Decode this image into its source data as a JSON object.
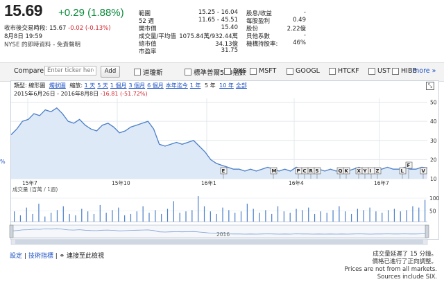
{
  "quote": {
    "price": "15.69",
    "change": "+0.29 (1.88%)",
    "after_hours_label": "收市後交易時段:",
    "after_hours_price": "15.67",
    "after_hours_change": "-0.02 (-0.13%)",
    "timestamp": "8月8日 19:59",
    "source_text": "NYSE 的即時資料 - 免責聲明"
  },
  "stats_left": [
    {
      "label": "範圍",
      "value": "15.25 - 16.04"
    },
    {
      "label": "52 週",
      "value": "11.65 - 45.51"
    },
    {
      "label": "開市價",
      "value": "15.40"
    },
    {
      "label": "成交量/平均值",
      "value": "1075.84萬/932.44萬"
    },
    {
      "label": "總市值",
      "value": "34.13億"
    },
    {
      "label": "市盈率",
      "value": "31.75"
    }
  ],
  "stats_right": [
    {
      "label": "股息/收益",
      "value": "-"
    },
    {
      "label": "每股盈利",
      "value": "0.49"
    },
    {
      "label": "股份",
      "value": "2.22億"
    },
    {
      "label": "貝他系數",
      "value": "-"
    },
    {
      "label": "機構持股率:",
      "value": "46%"
    }
  ],
  "compare": {
    "label": "Compare:",
    "placeholder": "Enter ticker here",
    "add_label": "Add",
    "checkboxes": [
      "道瓊斯",
      "標準普爾500指數",
      "DKS",
      "MSFT",
      "GOOGL",
      "HTCKF",
      "UST",
      "HIBB"
    ],
    "more_label": "more »"
  },
  "chart_controls": {
    "type_label": "類型:",
    "type_selected": "線形圖",
    "type_other": "燭狀圖",
    "zoom_label": "縮放:",
    "zoom_options": [
      "1 天",
      "5 天",
      "1 個月",
      "3 個月",
      "6 個月",
      "本年迄今",
      "1 年"
    ],
    "zoom_selected": "5 年",
    "zoom_more": [
      "10 年",
      "全部"
    ],
    "date_range": "2015年6月26日 - 2016年8月8日",
    "range_change": "-16.81 (-51.72%)"
  },
  "volume_label": "成交量 (百萬 / 1週)",
  "navigator_year": "2016",
  "edge_mark": "%",
  "footer": {
    "settings": "設定",
    "separator": "|",
    "indicators": "技術指標",
    "link_label": "連接至此檢視",
    "note_lines": [
      "成交量延遲了 15 分鐘。",
      "價格已進行了正向調整。",
      "Prices are not from all markets.",
      "Sources include SIX."
    ]
  },
  "chart_data": {
    "type": "line",
    "x_tick_labels": [
      "15年7",
      "15年10",
      "16年1",
      "16年4",
      "16年7"
    ],
    "y_tick_labels": [
      "50",
      "40",
      "30",
      "20",
      "10"
    ],
    "ylim": [
      10,
      52
    ],
    "price_points": [
      33,
      36,
      40,
      41,
      44,
      43,
      46,
      45,
      47,
      44,
      40,
      39,
      41,
      38,
      36,
      35,
      38,
      39,
      37,
      34,
      35,
      37,
      38,
      39,
      40,
      36,
      28,
      27,
      28,
      29,
      28,
      29,
      30,
      27,
      24,
      20,
      18,
      17,
      16,
      15,
      15,
      14,
      15,
      14,
      15,
      16,
      15,
      14,
      15,
      14,
      16,
      15,
      15,
      14,
      15,
      14,
      15,
      14,
      15,
      14,
      15,
      16,
      15,
      14,
      15,
      15,
      16,
      15,
      15,
      16,
      15,
      15,
      16,
      15.7
    ],
    "event_flags": [
      "E",
      "M",
      "P",
      "C",
      "R",
      "S",
      "Q",
      "K",
      "X",
      "Y",
      "I",
      "Z",
      "L",
      "F",
      "V"
    ],
    "volume_ticks": [
      "100",
      "50"
    ],
    "volume_bars": [
      40,
      25,
      55,
      30,
      70,
      20,
      35,
      45,
      60,
      30,
      25,
      50,
      40,
      30,
      65,
      35,
      45,
      55,
      25,
      30,
      40,
      60,
      35,
      45,
      30,
      50,
      80,
      35,
      40,
      45,
      100,
      60,
      40,
      30,
      55,
      45,
      35,
      40,
      70,
      50,
      35,
      45,
      30,
      60,
      40,
      35,
      50,
      45,
      55,
      30,
      40,
      35,
      45,
      60,
      40,
      30,
      50,
      45,
      55,
      40,
      35,
      45,
      50,
      40,
      45,
      60,
      55,
      85
    ]
  }
}
